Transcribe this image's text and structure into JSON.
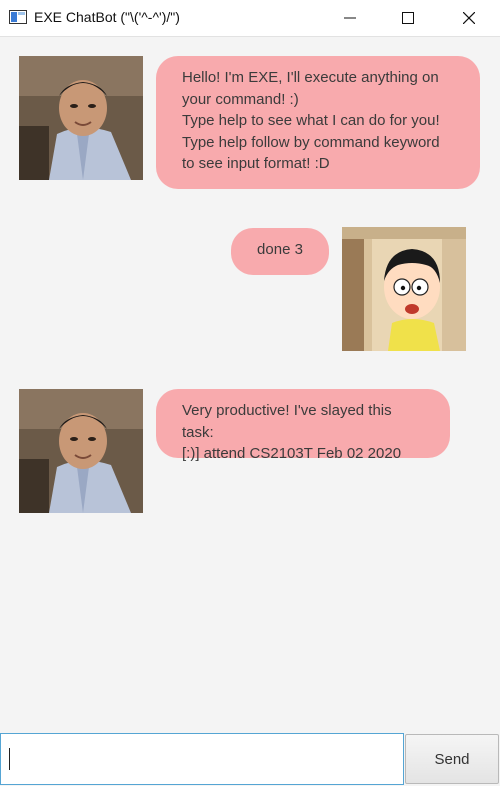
{
  "window": {
    "title": "EXE ChatBot (\"\\('^-^')/\")"
  },
  "messages": [
    {
      "sender": "bot",
      "avatar_icon": "bot-avatar",
      "text": "Hello! I'm EXE, I'll execute anything on\nyour command! :)\nType help to see what I can do for you!\nType help follow by command keyword\nto see input format! :D"
    },
    {
      "sender": "user",
      "avatar_icon": "user-avatar-cartoon",
      "text": "done 3"
    },
    {
      "sender": "bot",
      "avatar_icon": "bot-avatar",
      "text": "Very productive! I've slayed this task:\n[:)] attend CS2103T Feb 02 2020"
    }
  ],
  "input": {
    "value": "",
    "placeholder": ""
  },
  "send_button": {
    "label": "Send"
  },
  "colors": {
    "bubble": "#f8aaad",
    "background": "#f4f4f4",
    "input_border": "#55a5d4"
  }
}
